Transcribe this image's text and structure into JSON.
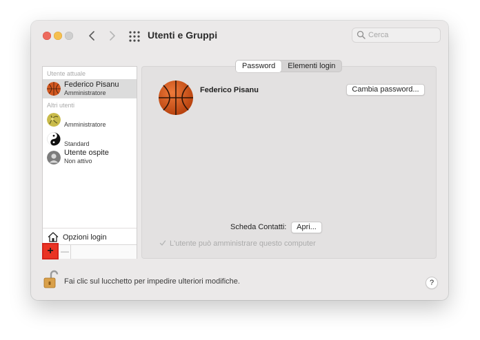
{
  "window": {
    "title": "Utenti e Gruppi",
    "search_placeholder": "Cerca"
  },
  "sidebar": {
    "current_user_label": "Utente attuale",
    "current_user": {
      "name": "Federico Pisanu",
      "role": "Amministratore",
      "avatar": "basketball-icon"
    },
    "other_users_label": "Altri utenti",
    "other_users": [
      {
        "name": "",
        "role": "Amministratore",
        "avatar": "flower-icon"
      },
      {
        "name": "",
        "role": "Standard",
        "avatar": "yin-yang-icon"
      },
      {
        "name": "Utente ospite",
        "role": "Non attivo",
        "avatar": "guest-person-icon"
      }
    ],
    "login_options_label": "Opzioni login",
    "add_label": "+",
    "remove_label": "—"
  },
  "main": {
    "tabs": [
      {
        "label": "Password",
        "active": true
      },
      {
        "label": "Elementi login",
        "active": false
      }
    ],
    "user_name": "Federico Pisanu",
    "change_password_label": "Cambia password...",
    "contacts_label": "Scheda Contatti:",
    "open_label": "Apri...",
    "admin_checkbox_label": "L'utente può amministrare questo computer",
    "admin_checked": true
  },
  "footer": {
    "lock_text": "Fai clic sul lucchetto per impedire ulteriori modifiche.",
    "help_label": "?"
  },
  "colors": {
    "highlight": "#ea3323",
    "selection": "#dcdcdc"
  }
}
